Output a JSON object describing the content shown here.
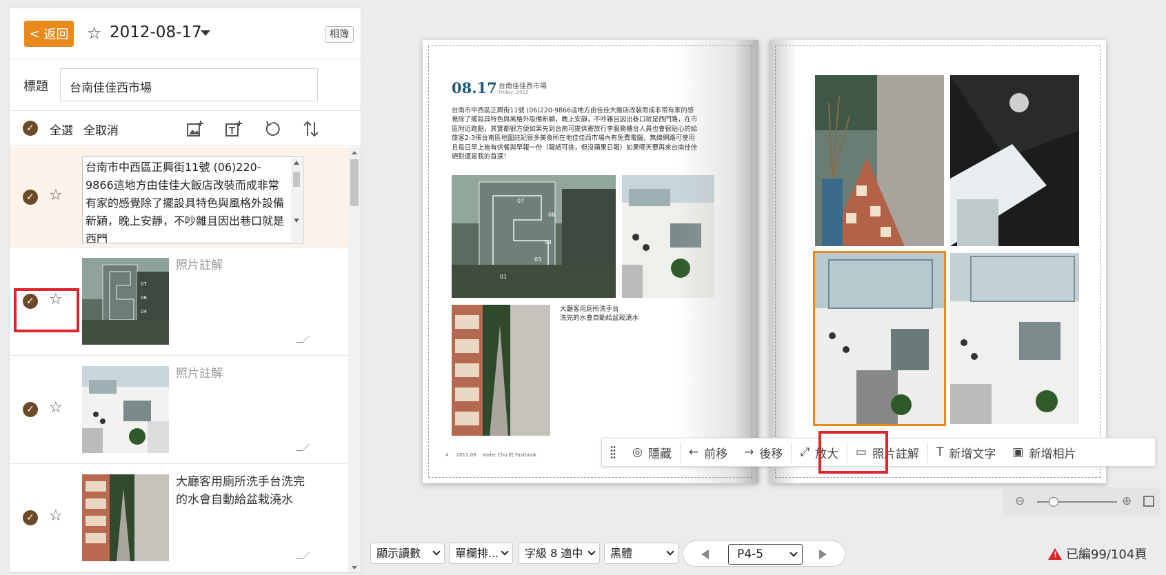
{
  "header": {
    "back_label": "返回",
    "date": "2012-08-17",
    "album_label": "相簿"
  },
  "title": {
    "label": "標題",
    "value": "台南佳佳西市場"
  },
  "tools": {
    "select_all": "全選",
    "deselect_all": "全取消"
  },
  "items": [
    {
      "type": "text",
      "text": "台南市中西區正興街11號 (06)220-9866這地方由佳佳大飯店改裝而成非常有家的感覺除了擺設具特色與風格外設備新穎，晚上安靜，不吵雜且因出巷口就是西門"
    },
    {
      "type": "photo",
      "caption": "照片註解",
      "placeholder": true
    },
    {
      "type": "photo",
      "caption": "照片註解",
      "placeholder": true
    },
    {
      "type": "photo",
      "caption": "大廳客用廁所洗手台洗完的水會自動給盆栽澆水",
      "placeholder": false
    }
  ],
  "book": {
    "left": {
      "date": "08.17",
      "title": "台南佳佳西市場",
      "weekday": "Friday, 2012",
      "body": "台南市中西區正興街11號 (06)220-9866這地方由佳佳大飯店改裝而成非常有家的感覺除了擺設具特色與風格外設備新穎，晚上安靜，不吵雜且因出巷口就是西門路，在市區附近跑點，其實都很方便如果先到台南可提供寄放行李服務櫃台人員也會很貼心的給旅客2-3張台南區地圖註記很多美食所在地佳佳西市場內有免費電腦，無線網路可使用且每日早上皆有供餐與早報一份（報紙可挑，但沒蘋果日報）如果哪天要再來台南佳佳絕對還是我的首選！",
      "caption": "大廳客用廁所洗手台\n洗完的水會自動給盆栽澆水",
      "footer_page": "4",
      "footer_date": "2012.08",
      "footer_author": "Vader Chu 的 Fastbook"
    }
  },
  "floating_toolbar": {
    "hide": "隱藏",
    "move_prev": "前移",
    "move_next": "後移",
    "enlarge": "放大",
    "photo_note": "照片註解",
    "add_text": "新增文字",
    "add_photo": "新增相片"
  },
  "bottom": {
    "display_mode": "顯示讀數",
    "layout": "單欄排...",
    "font_size": "字級 8 適中",
    "font": "黑體",
    "page": "P4-5",
    "status": "已編99/104頁"
  },
  "colors": {
    "accent": "#e88a1c",
    "check": "#6b4a2a",
    "highlight": "#e0242c",
    "title_blue": "#1c5a7a"
  }
}
